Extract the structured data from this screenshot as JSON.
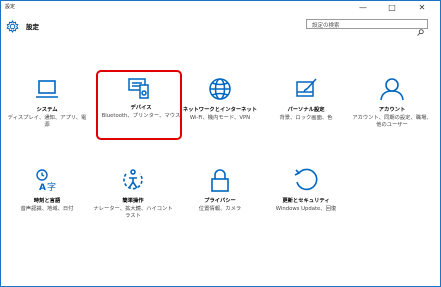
{
  "window": {
    "title": "設定",
    "controls": {
      "minimize": "—",
      "maximize": "□",
      "close": "✕"
    }
  },
  "header": {
    "title": "設定",
    "search_placeholder": "設定の検索"
  },
  "accent_color": "#0067c0",
  "highlight_color": "#e00000",
  "tiles": [
    {
      "name": "システム",
      "desc": "ディスプレイ、通知、アプリ、電源",
      "icon": "laptop-icon"
    },
    {
      "name": "デバイス",
      "desc": "Bluetooth、プリンター、マウス",
      "icon": "devices-icon",
      "selected": true
    },
    {
      "name": "ネットワークとインターネット",
      "desc": "Wi-Fi、機内モード、VPN",
      "icon": "globe-icon"
    },
    {
      "name": "パーソナル設定",
      "desc": "背景、ロック画面、色",
      "icon": "personalization-icon"
    },
    {
      "name": "アカウント",
      "desc": "アカウント、同期の設定、職場、他のユーザー",
      "icon": "person-icon"
    },
    {
      "name": "時刻と言語",
      "desc": "音声認識、地域、日付",
      "icon": "time-language-icon"
    },
    {
      "name": "簡単操作",
      "desc": "ナレーター、拡大鏡、ハイコントラスト",
      "icon": "ease-of-access-icon"
    },
    {
      "name": "プライバシー",
      "desc": "位置情報、カメラ",
      "icon": "lock-icon"
    },
    {
      "name": "更新とセキュリティ",
      "desc": "Windows Update、回復",
      "icon": "update-icon"
    }
  ]
}
